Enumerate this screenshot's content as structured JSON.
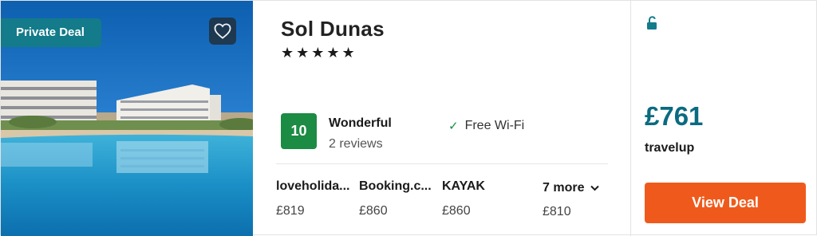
{
  "photo": {
    "badge": "Private Deal",
    "favorite_icon": "heart-icon"
  },
  "hotel": {
    "name": "Sol Dunas",
    "stars": "★★★★★",
    "star_count": 5,
    "rating": {
      "score": "10",
      "label": "Wonderful",
      "reviews": "2 reviews",
      "color": "#1c8b43"
    },
    "amenity": {
      "icon": "check-icon",
      "label": "Free Wi-Fi"
    }
  },
  "providers": [
    {
      "name": "loveholida...",
      "price": "£819"
    },
    {
      "name": "Booking.c...",
      "price": "£860"
    },
    {
      "name": "KAYAK",
      "price": "£860"
    }
  ],
  "more": {
    "label": "7 more",
    "price": "£810",
    "icon": "chevron-down-icon"
  },
  "deal": {
    "lock_icon": "unlock-icon",
    "price": "£761",
    "provider": "travelup",
    "button": "View Deal"
  },
  "colors": {
    "accent": "#137b8a",
    "price": "#0a6b80",
    "cta": "#ef5a1c"
  }
}
